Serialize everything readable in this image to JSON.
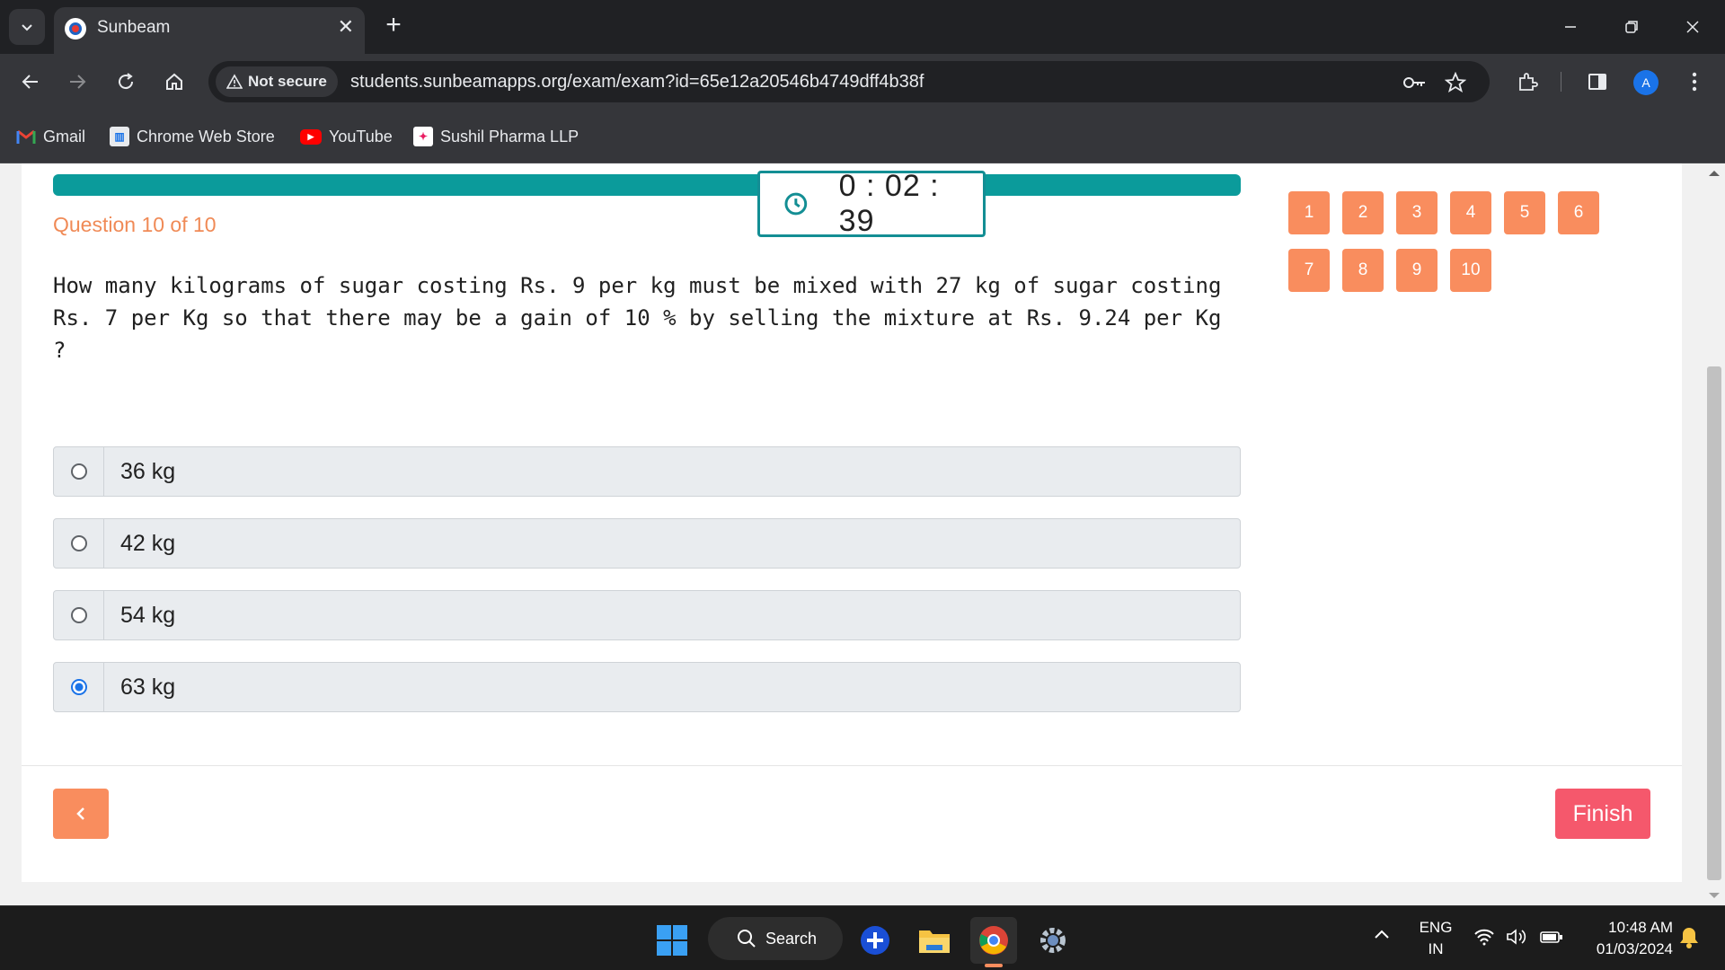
{
  "browser": {
    "tab_title": "Sunbeam",
    "security_label": "Not secure",
    "url": "students.sunbeamapps.org/exam/exam?id=65e12a20546b4749dff4b38f",
    "profile_initial": "A"
  },
  "bookmarks": [
    {
      "label": "Gmail",
      "icon": "gmail-icon"
    },
    {
      "label": "Chrome Web Store",
      "icon": "chrome-web-store-icon"
    },
    {
      "label": "YouTube",
      "icon": "youtube-icon"
    },
    {
      "label": "Sushil Pharma LLP",
      "icon": "sushil-pharma-icon"
    }
  ],
  "exam": {
    "timer": "0 : 02 : 39",
    "question_counter": "Question 10 of 10",
    "question_text": "How many kilograms of sugar costing Rs. 9 per kg must be mixed with 27 kg of sugar costing Rs. 7 per Kg so that there may be a gain of 10 % by selling the mixture at Rs. 9.24 per Kg ?",
    "options": [
      {
        "label": "36 kg",
        "selected": false
      },
      {
        "label": "42 kg",
        "selected": false
      },
      {
        "label": "54 kg",
        "selected": false
      },
      {
        "label": "63 kg",
        "selected": true
      }
    ],
    "question_nav": [
      "1",
      "2",
      "3",
      "4",
      "5",
      "6",
      "7",
      "8",
      "9",
      "10"
    ],
    "prev_label": "<",
    "finish_label": "Finish"
  },
  "taskbar": {
    "search_label": "Search",
    "language": "ENG",
    "region": "IN",
    "time": "10:48 AM",
    "date": "01/03/2024"
  },
  "colors": {
    "accent_orange": "#f98d5e",
    "finish_red": "#f5586c",
    "progress_teal": "#0b9b9b"
  }
}
